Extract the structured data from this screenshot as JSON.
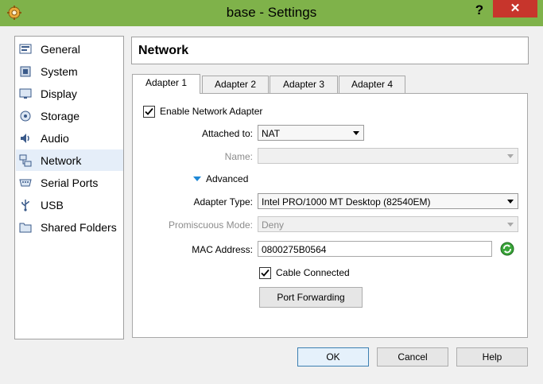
{
  "window": {
    "title": "base - Settings",
    "help_label": "?",
    "close_label": "✕"
  },
  "sidebar": {
    "items": [
      {
        "label": "General",
        "icon": "general-icon"
      },
      {
        "label": "System",
        "icon": "system-icon"
      },
      {
        "label": "Display",
        "icon": "display-icon"
      },
      {
        "label": "Storage",
        "icon": "storage-icon"
      },
      {
        "label": "Audio",
        "icon": "audio-icon"
      },
      {
        "label": "Network",
        "icon": "network-icon",
        "selected": true
      },
      {
        "label": "Serial Ports",
        "icon": "serial-ports-icon"
      },
      {
        "label": "USB",
        "icon": "usb-icon"
      },
      {
        "label": "Shared Folders",
        "icon": "shared-folders-icon"
      }
    ]
  },
  "header": {
    "title": "Network"
  },
  "tabs": [
    {
      "label": "Adapter 1",
      "active": true
    },
    {
      "label": "Adapter 2"
    },
    {
      "label": "Adapter 3"
    },
    {
      "label": "Adapter 4"
    }
  ],
  "form": {
    "enable_label": "Enable Network Adapter",
    "enable_checked": true,
    "attached_label": "Attached to:",
    "attached_value": "NAT",
    "name_label": "Name:",
    "name_value": "",
    "advanced_label": "Advanced",
    "adapter_type_label": "Adapter Type:",
    "adapter_type_value": "Intel PRO/1000 MT Desktop (82540EM)",
    "promisc_label": "Promiscuous Mode:",
    "promisc_value": "Deny",
    "mac_label": "MAC Address:",
    "mac_value": "0800275B0564",
    "cable_label": "Cable Connected",
    "cable_checked": true,
    "port_forwarding_label": "Port Forwarding"
  },
  "footer": {
    "ok_label": "OK",
    "cancel_label": "Cancel",
    "help_label": "Help"
  },
  "colors": {
    "titlebar": "#7fb24a",
    "close": "#c7352c",
    "selection": "#e5eef9",
    "accent": "#1e88d6"
  }
}
